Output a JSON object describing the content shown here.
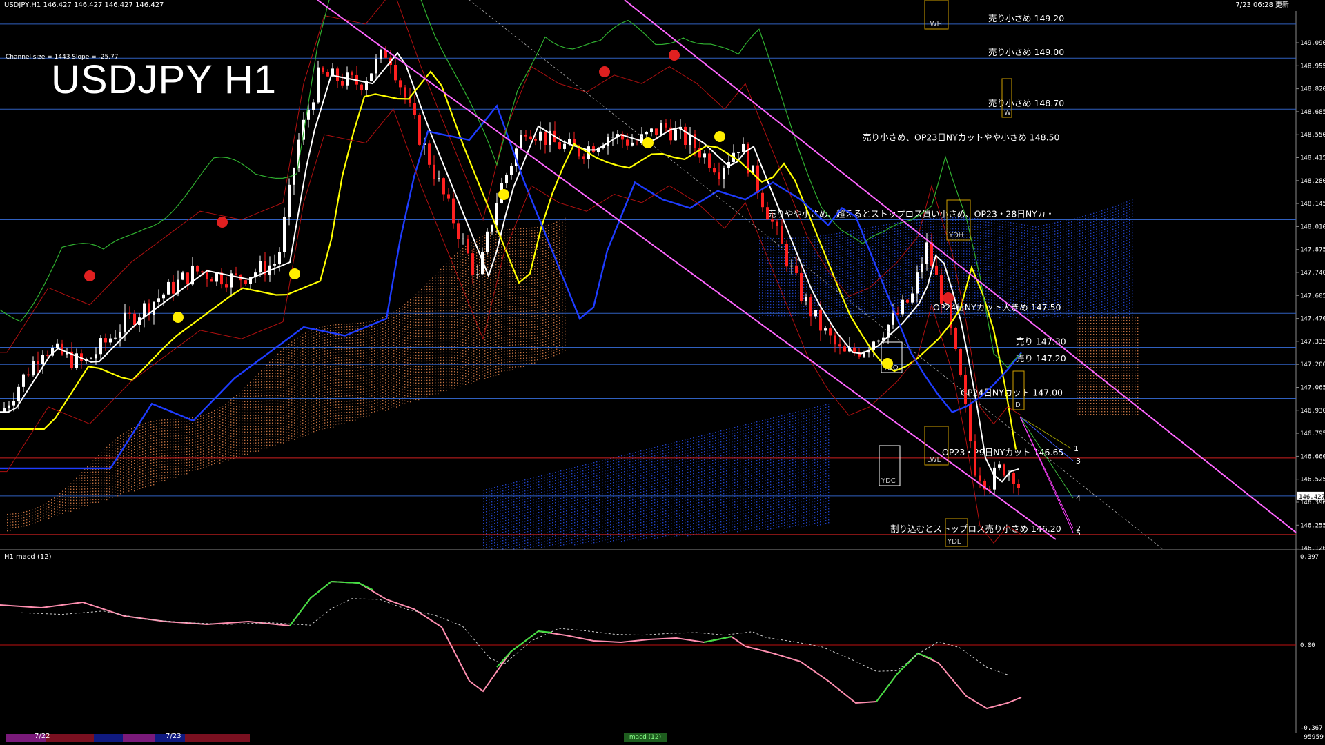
{
  "topbar": {
    "symbol_info": "USDJPY,H1  146.427 146.427 146.427 146.427",
    "updated": "7/23 06:28 更新"
  },
  "chart": {
    "title": "USDJPY H1",
    "channel_info": "Channel size = 1443 Slope = -25.77",
    "current_price": "146.427",
    "price_ticks": [
      "149.090",
      "148.955",
      "148.820",
      "148.685",
      "148.550",
      "148.415",
      "148.280",
      "148.145",
      "148.010",
      "147.875",
      "147.740",
      "147.605",
      "147.470",
      "147.335",
      "147.200",
      "147.065",
      "146.930",
      "146.795",
      "146.660",
      "146.525",
      "146.390",
      "146.255",
      "146.120"
    ],
    "levels": [
      {
        "text": "売り小さめ 149.20"
      },
      {
        "text": "売り小さめ 149.00"
      },
      {
        "text": "売り小さめ 148.70"
      },
      {
        "text": "売り小さめ、OP23日NYカットやや小さめ 148.50"
      },
      {
        "text": "売りやや小さめ、超えるとストップロス買い小さめ、OP23・28日NYカ・"
      },
      {
        "text": "OP24日NYカット大きめ 147.50"
      },
      {
        "text": "売り 147.30"
      },
      {
        "text": "売り 147.20"
      },
      {
        "text": "OP24日NYカット 147.00"
      },
      {
        "text": "OP23・29日NYカット 146.65"
      },
      {
        "text": "割り込むとストップロス売り小さめ 146.20"
      }
    ],
    "box_labels": {
      "lwh": "LWH",
      "ydh": "YDH",
      "ydo": "YDO",
      "ydc": "YDC",
      "ydl": "YDL",
      "lwl": "LWL",
      "d": "D",
      "w": "W"
    },
    "fan_labels": [
      "1",
      "3",
      "4",
      "2",
      "5"
    ]
  },
  "macd": {
    "header": "H1  macd (12)",
    "ticks": [
      "0.397",
      "0.00",
      "-0.367"
    ]
  },
  "bottom": {
    "date1": "7/22",
    "date2": "7/23",
    "scroll_label": "macd (12)",
    "right_value": "95959"
  },
  "colors": {
    "background": "#000000",
    "candle_up": "#ffffff",
    "candle_down": "#ff2020",
    "ma_white": "#ffffff",
    "ma_yellow": "#ffff00",
    "ma_blue": "#1e3cff",
    "trend_magenta": "#ff66ff",
    "level_line": "#3060c0",
    "red_line": "#ff2020",
    "macd_main": "#ff8fb0",
    "macd_green": "#40e040"
  }
}
